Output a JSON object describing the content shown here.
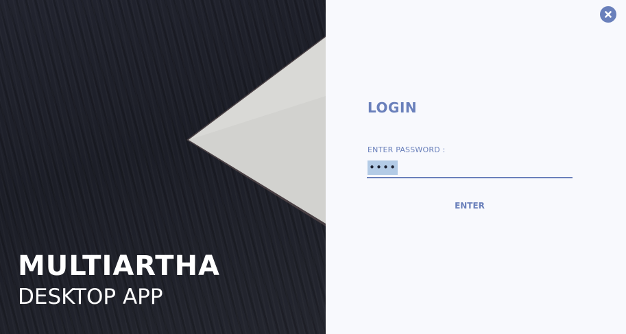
{
  "brand": {
    "name": "MULTIARTHA",
    "subtitle": "DESKTOP APP"
  },
  "login": {
    "title": "LOGIN",
    "password_label": "ENTER PASSWORD :",
    "password_value": "••••",
    "enter_label": "ENTER"
  },
  "icons": {
    "close": "close-icon"
  },
  "colors": {
    "accent": "#6a80bb",
    "panel_background": "#f8f9fd",
    "hero_background": "#1f2129",
    "selection_highlight": "#b3cbe6",
    "paper_shape": "#d3d3d0"
  }
}
